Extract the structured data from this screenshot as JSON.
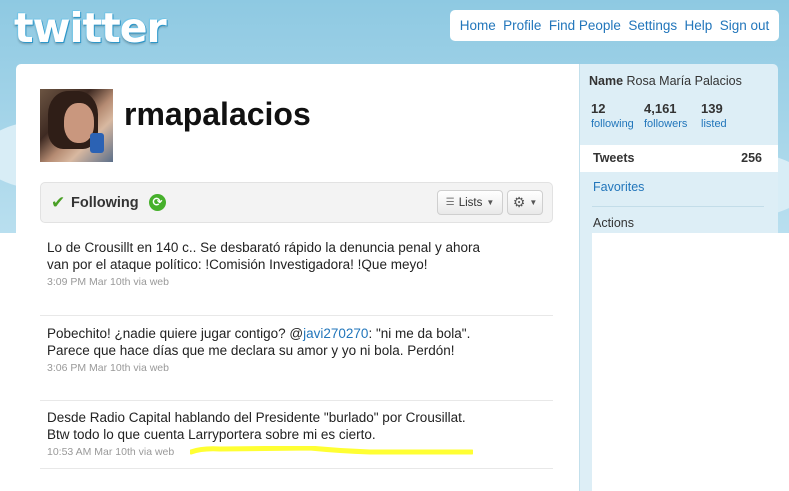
{
  "logo": {
    "text": "twitter"
  },
  "nav": {
    "items": [
      "Home",
      "Profile",
      "Find People",
      "Settings",
      "Help",
      "Sign out"
    ]
  },
  "profile": {
    "screen_name": "rmapalacios"
  },
  "following_bar": {
    "status_label": "Following",
    "lists_label": "Lists"
  },
  "tweets": [
    {
      "text": "Lo de Crousillt en 140 c.. Se desbarató rápido la denuncia penal y ahora van por el ataque político: !Comisión Investigadora! !Que meyo!",
      "meta": "3:09 PM Mar 10th via web"
    },
    {
      "text_before": "Pobechito! ¿nadie quiere jugar contigo? @",
      "mention": "javi270270",
      "text_after": ": \"ni me da bola\". Parece que hace días que me declara su amor y yo ni bola. Perdón!",
      "meta": "3:06 PM Mar 10th via web"
    },
    {
      "text": "Desde Radio Capital hablando del Presidente \"burlado\" por Crousillat. Btw todo lo que cuenta Larryportera sobre mi es cierto.",
      "meta": "10:53 AM Mar 10th via web"
    }
  ],
  "sidebar": {
    "name_label": "Name",
    "name_value": "Rosa María Palacios",
    "stats": [
      {
        "num": "12",
        "label": "following"
      },
      {
        "num": "4,161",
        "label": "followers"
      },
      {
        "num": "139",
        "label": "listed"
      }
    ],
    "tweets_label": "Tweets",
    "tweets_count": "256",
    "favorites_label": "Favorites",
    "actions_label": "Actions"
  },
  "colors": {
    "link": "#2276bb",
    "sky": "#8ec9e2",
    "sidebar_bg": "#ddeef6",
    "highlight": "#ffff33"
  }
}
